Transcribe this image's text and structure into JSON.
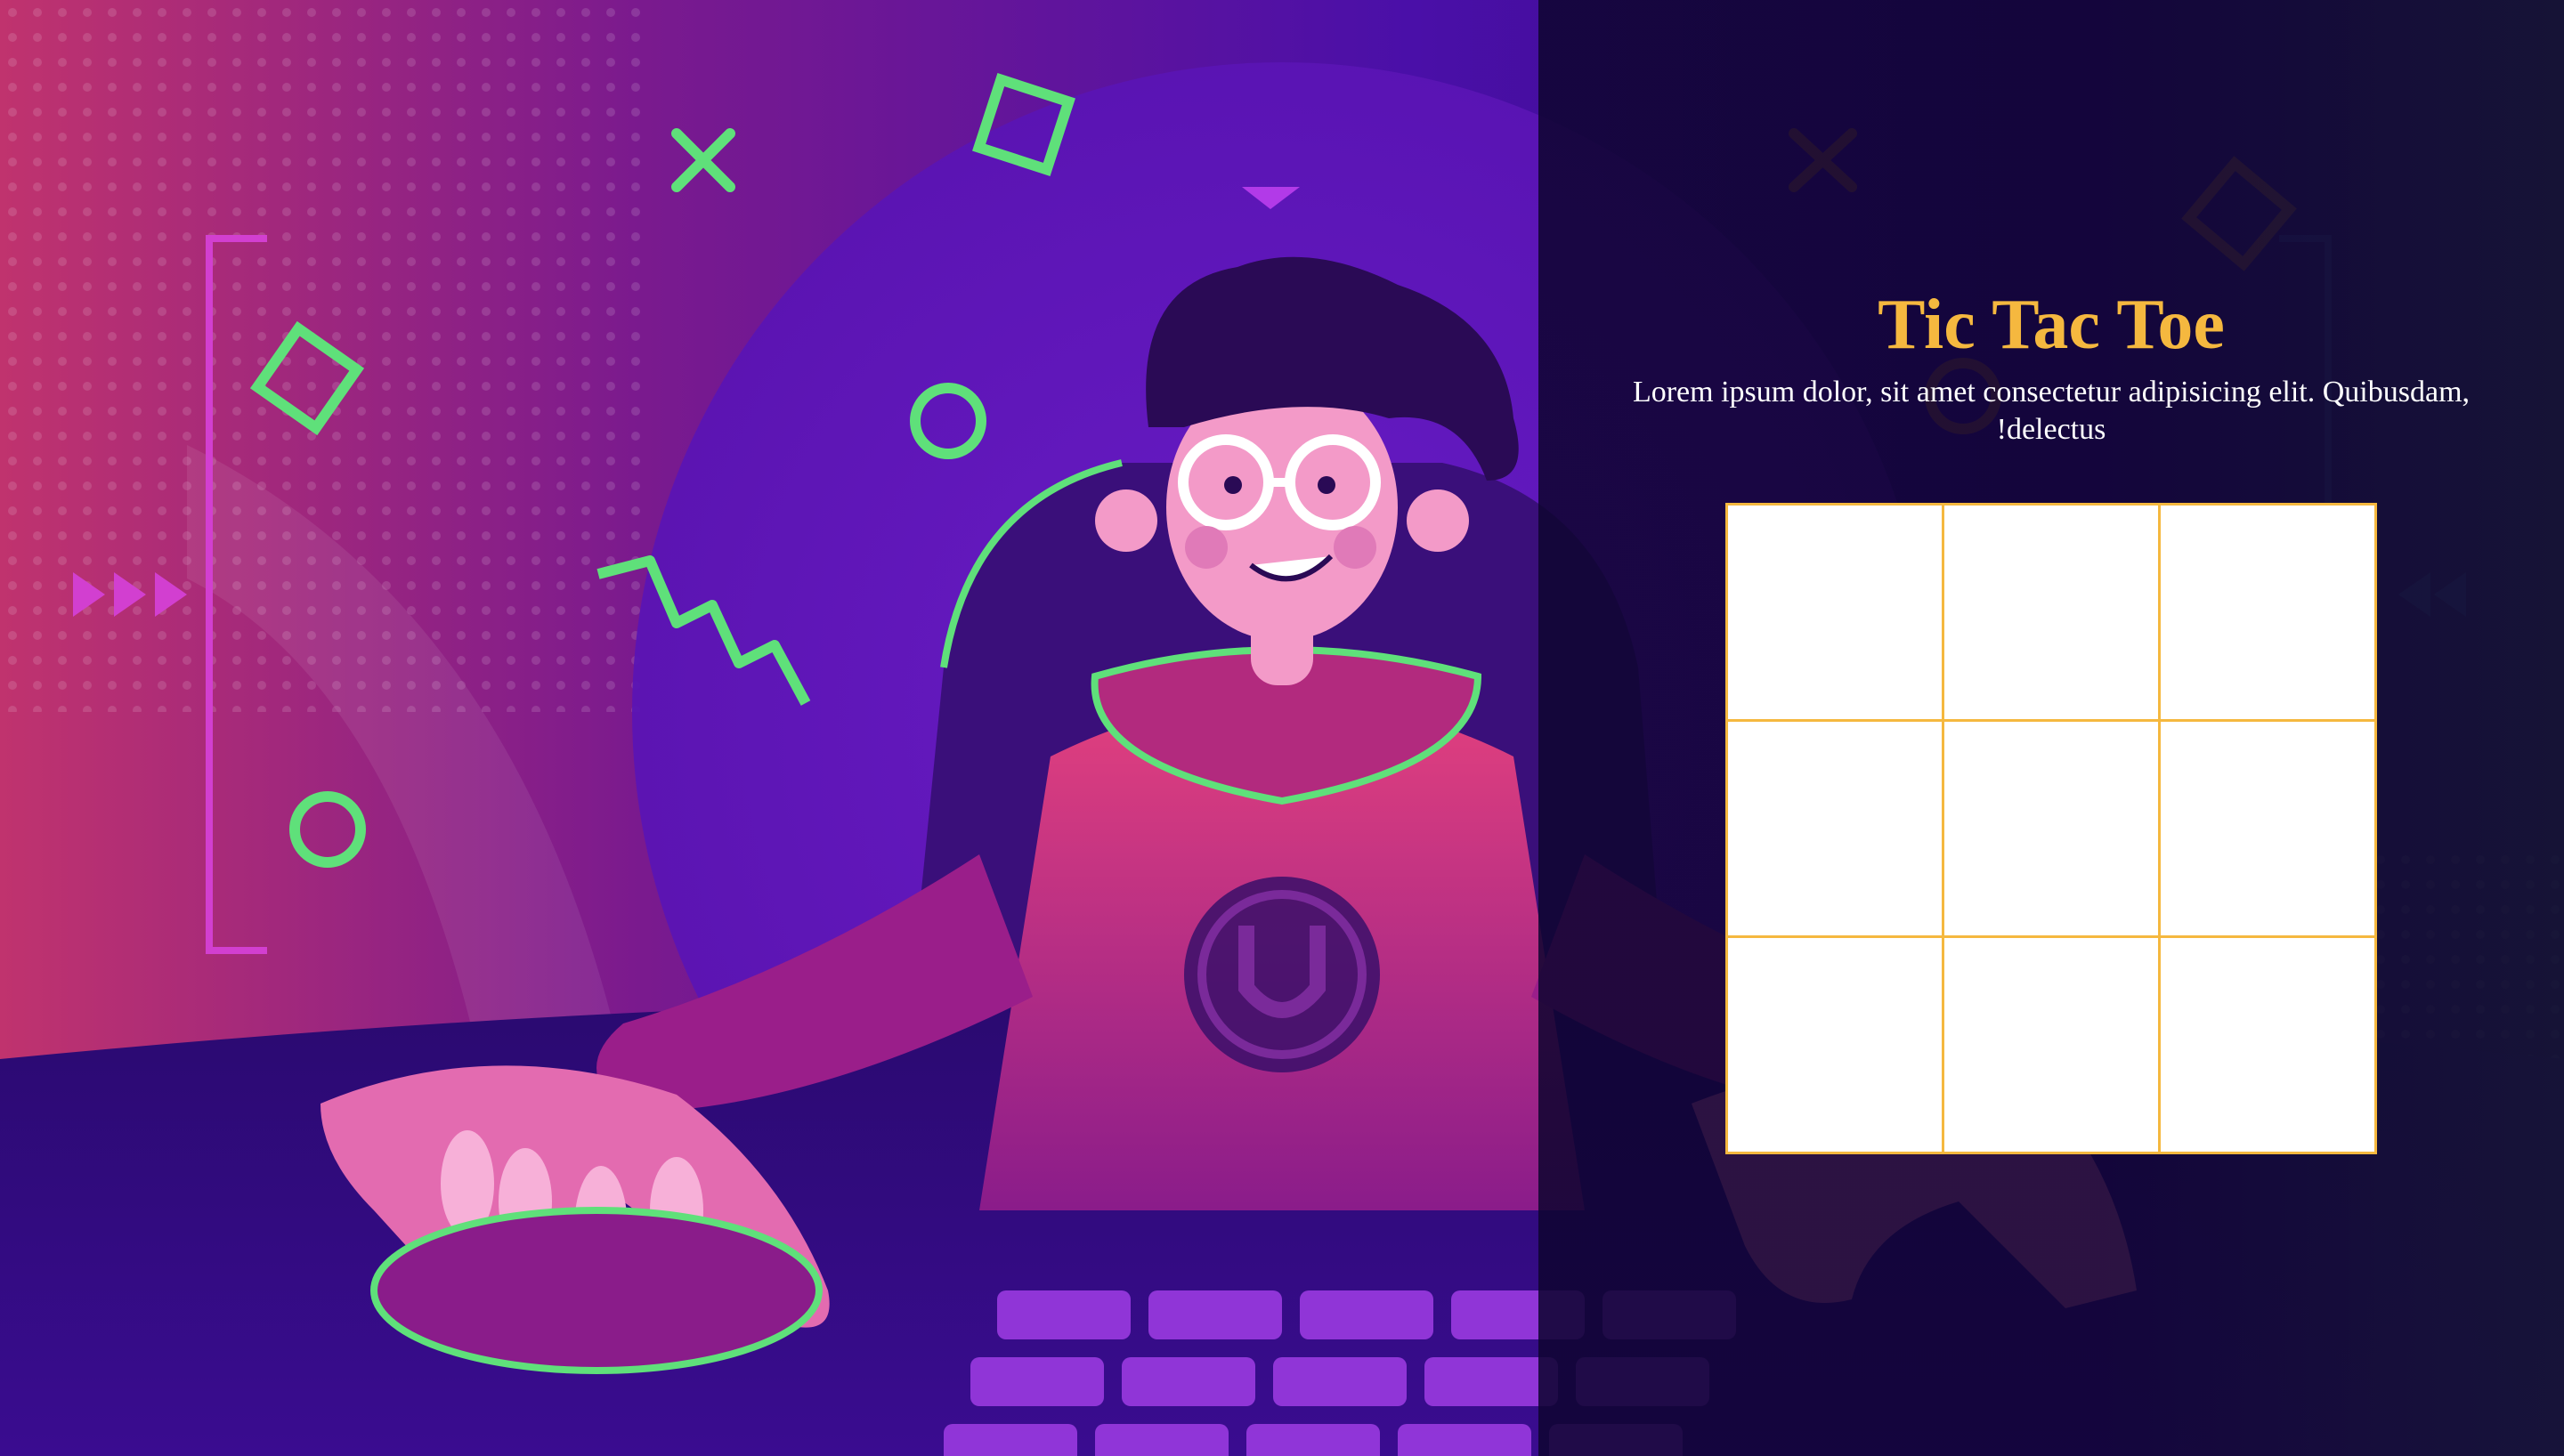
{
  "game": {
    "title": "Tic Tac Toe",
    "subtitle": "Lorem ipsum dolor, sit amet consectetur adipisicing elit. Quibusdam, !delectus"
  },
  "board": {
    "cells": [
      "",
      "",
      "",
      "",
      "",
      "",
      "",
      "",
      ""
    ]
  },
  "colors": {
    "accent": "#f5b83f",
    "cell_background": "#ffffff",
    "overlay": "#0e0430",
    "neon_green": "#5fe07a",
    "magenta": "#e0409a",
    "purple": "#5a12b0"
  }
}
